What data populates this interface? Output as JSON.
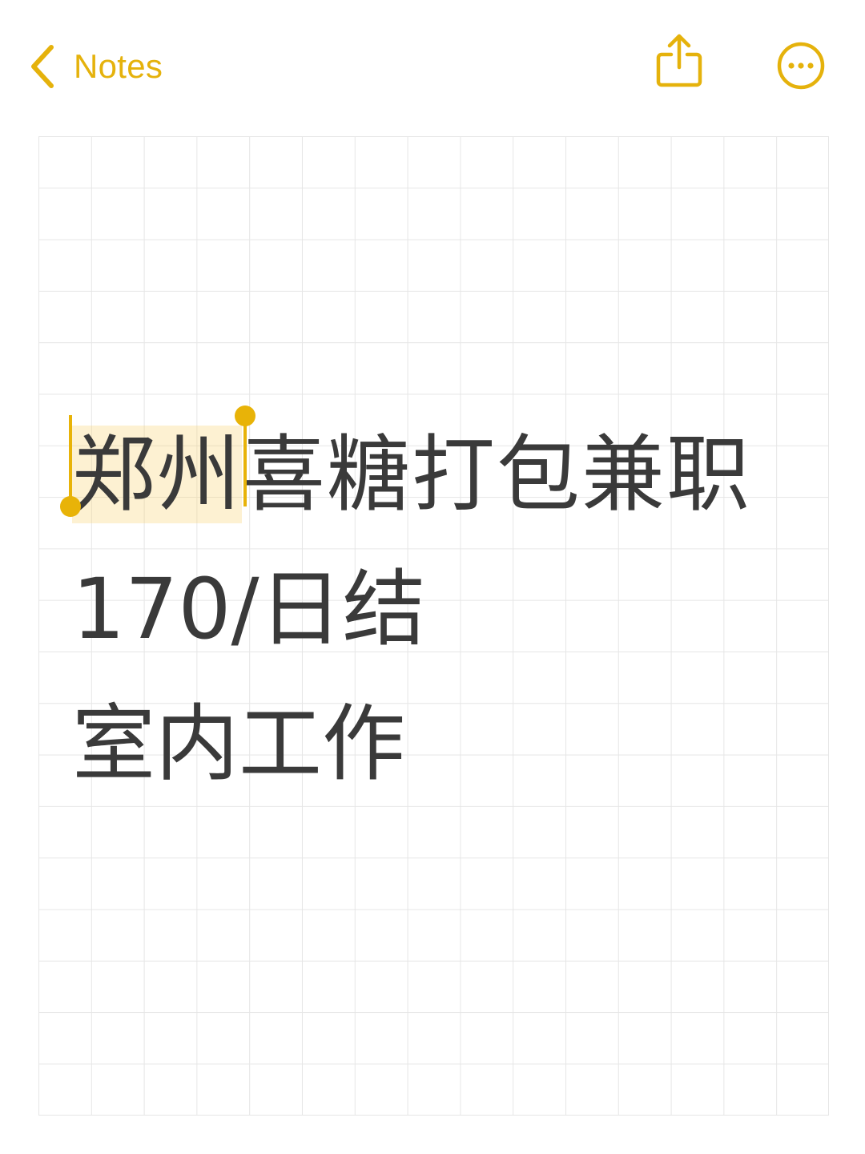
{
  "topbar": {
    "back_label": "Notes",
    "back_icon": "chevron-left-icon",
    "share_icon": "share-icon",
    "more_icon": "ellipsis-circle-icon",
    "accent_color": "#e5b20c"
  },
  "note": {
    "line1_selected": "郑州",
    "line1_rest": "喜糖打包兼职",
    "line2": "170/日结",
    "line3": "室内工作",
    "selection_color": "#f7cd5c"
  }
}
